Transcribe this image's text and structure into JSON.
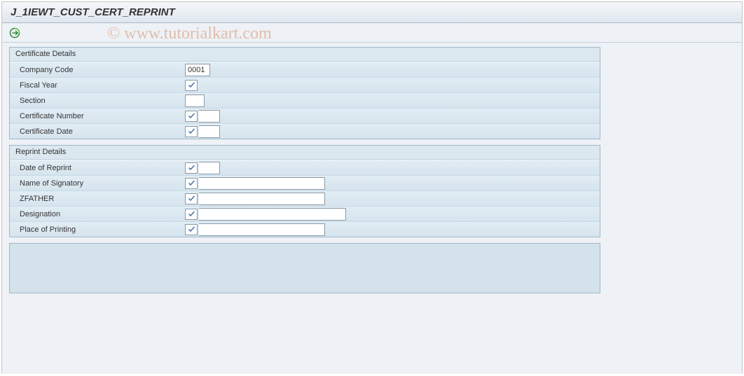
{
  "title": "J_1IEWT_CUST_CERT_REPRINT",
  "watermark": "© www.tutorialkart.com",
  "toolbar": {
    "execute_icon": "execute-icon"
  },
  "groups": {
    "certificate": {
      "title": "Certificate Details",
      "fields": {
        "company_code": {
          "label": "Company Code",
          "value": "0001",
          "checked": false
        },
        "fiscal_year": {
          "label": "Fiscal Year",
          "value": "",
          "checked": true
        },
        "section": {
          "label": "Section",
          "value": "",
          "checked": false
        },
        "certificate_number": {
          "label": "Certificate Number",
          "value": "",
          "checked": true
        },
        "certificate_date": {
          "label": "Certificate Date",
          "value": "",
          "checked": true
        }
      }
    },
    "reprint": {
      "title": "Reprint Details",
      "fields": {
        "date_of_reprint": {
          "label": "Date of Reprint",
          "value": "",
          "checked": true
        },
        "name_of_signatory": {
          "label": "Name of Signatory",
          "value": "",
          "checked": true
        },
        "zfather": {
          "label": "ZFATHER",
          "value": "",
          "checked": true
        },
        "designation": {
          "label": "Designation",
          "value": "",
          "checked": true
        },
        "place_of_printing": {
          "label": "Place of Printing",
          "value": "",
          "checked": true
        }
      }
    }
  }
}
